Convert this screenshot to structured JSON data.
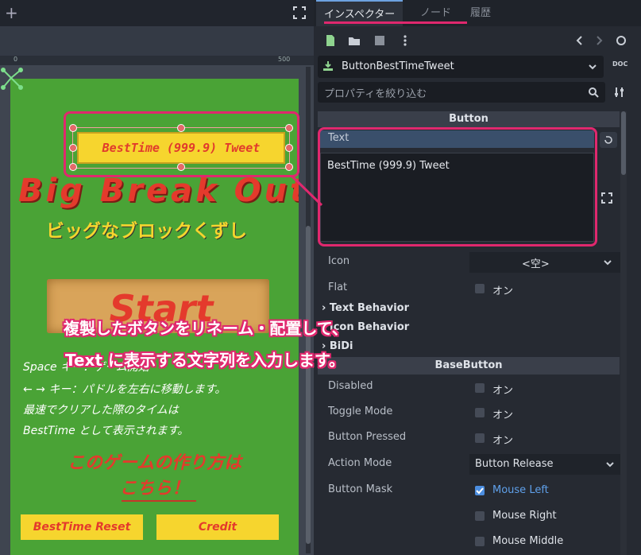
{
  "left_panel": {
    "plus_label": "+",
    "ruler_0": "0",
    "ruler_500": "500"
  },
  "game": {
    "best_tweet_button": "BestTime (999.9) Tweet",
    "title_en": "Big Break Out",
    "title_jp": "ビッグなブロックくずし",
    "start_label": "Start",
    "instructions": [
      "Space  キー：ゲーム開始",
      "← → キー：パドルを左右に移動します。",
      "最速でクリアした際のタイムは",
      "BestTime として表示されます。"
    ],
    "howto_line1": "このゲームの作り方は",
    "howto_line2": "こちら！",
    "reset_button": "BestTime Reset",
    "credit_button": "Credit"
  },
  "captions": {
    "line1": "複製したボタンをリネーム・配置して、",
    "line2": "Text に表示する文字列を入力します。"
  },
  "inspector": {
    "tabs": [
      "インスペクター",
      "ノード",
      "履歴"
    ],
    "node_name": "ButtonBestTimeTweet",
    "filter_placeholder": "プロパティを絞り込む",
    "section_button": "Button",
    "text_label": "Text",
    "text_value": "BestTime (999.9) Tweet",
    "icon_label": "Icon",
    "icon_value": "<空>",
    "flat_label": "Flat",
    "on_label": "オン",
    "text_behavior": "Text Behavior",
    "icon_behavior": "Icon Behavior",
    "bidi": "BiDi",
    "section_basebutton": "BaseButton",
    "disabled_label": "Disabled",
    "toggle_mode_label": "Toggle Mode",
    "button_pressed_label": "Button Pressed",
    "action_mode_label": "Action Mode",
    "action_mode_value": "Button Release",
    "button_mask_label": "Button Mask",
    "mouse_left": "Mouse Left",
    "mouse_right": "Mouse Right",
    "mouse_middle": "Mouse Middle",
    "doc_label": "DOC"
  }
}
